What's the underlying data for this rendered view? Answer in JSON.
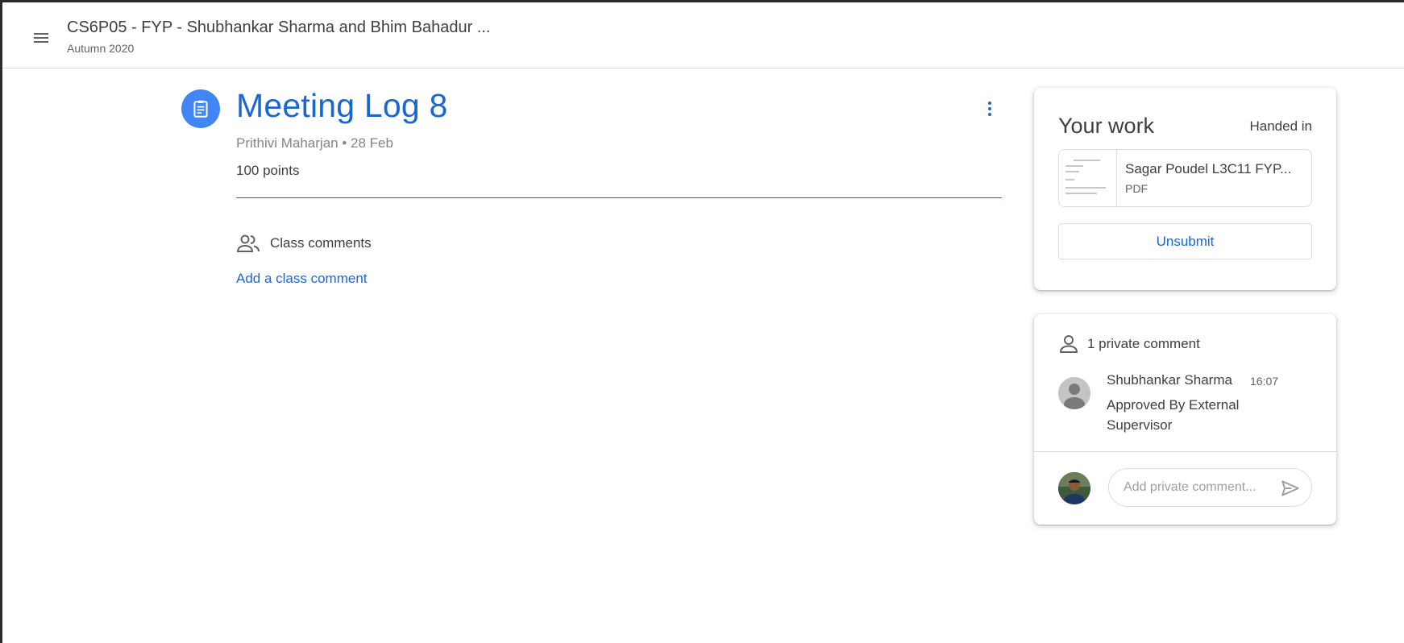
{
  "header": {
    "menu_icon": "hamburger-menu-icon",
    "class_title": "CS6P05 - FYP - Shubhankar Sharma and Bhim Bahadur ...",
    "class_subtitle": "Autumn 2020"
  },
  "assignment": {
    "icon": "assignment-clipboard-icon",
    "title": "Meeting Log 8",
    "meta": "Prithivi Maharjan • 28 Feb",
    "points": "100 points",
    "more_icon": "more-vertical-icon"
  },
  "class_comments": {
    "icon": "people-icon",
    "label": "Class comments",
    "add_link": "Add a class comment"
  },
  "your_work": {
    "title": "Your work",
    "status": "Handed in",
    "attachment": {
      "name": "Sagar Poudel L3C11 FYP...",
      "type": "PDF"
    },
    "unsubmit_label": "Unsubmit"
  },
  "private_comments": {
    "icon": "person-icon",
    "header": "1 private comment",
    "comments": [
      {
        "author": "Shubhankar Sharma",
        "time": "16:07",
        "text": "Approved By External Supervisor"
      }
    ],
    "input_placeholder": "Add private comment...",
    "send_icon": "send-icon"
  },
  "colors": {
    "accent_blue": "#1967d2",
    "icon_blue": "#4285f4",
    "text_dark": "#3c4043",
    "text_muted": "#5f6368",
    "border": "#dadce0"
  }
}
